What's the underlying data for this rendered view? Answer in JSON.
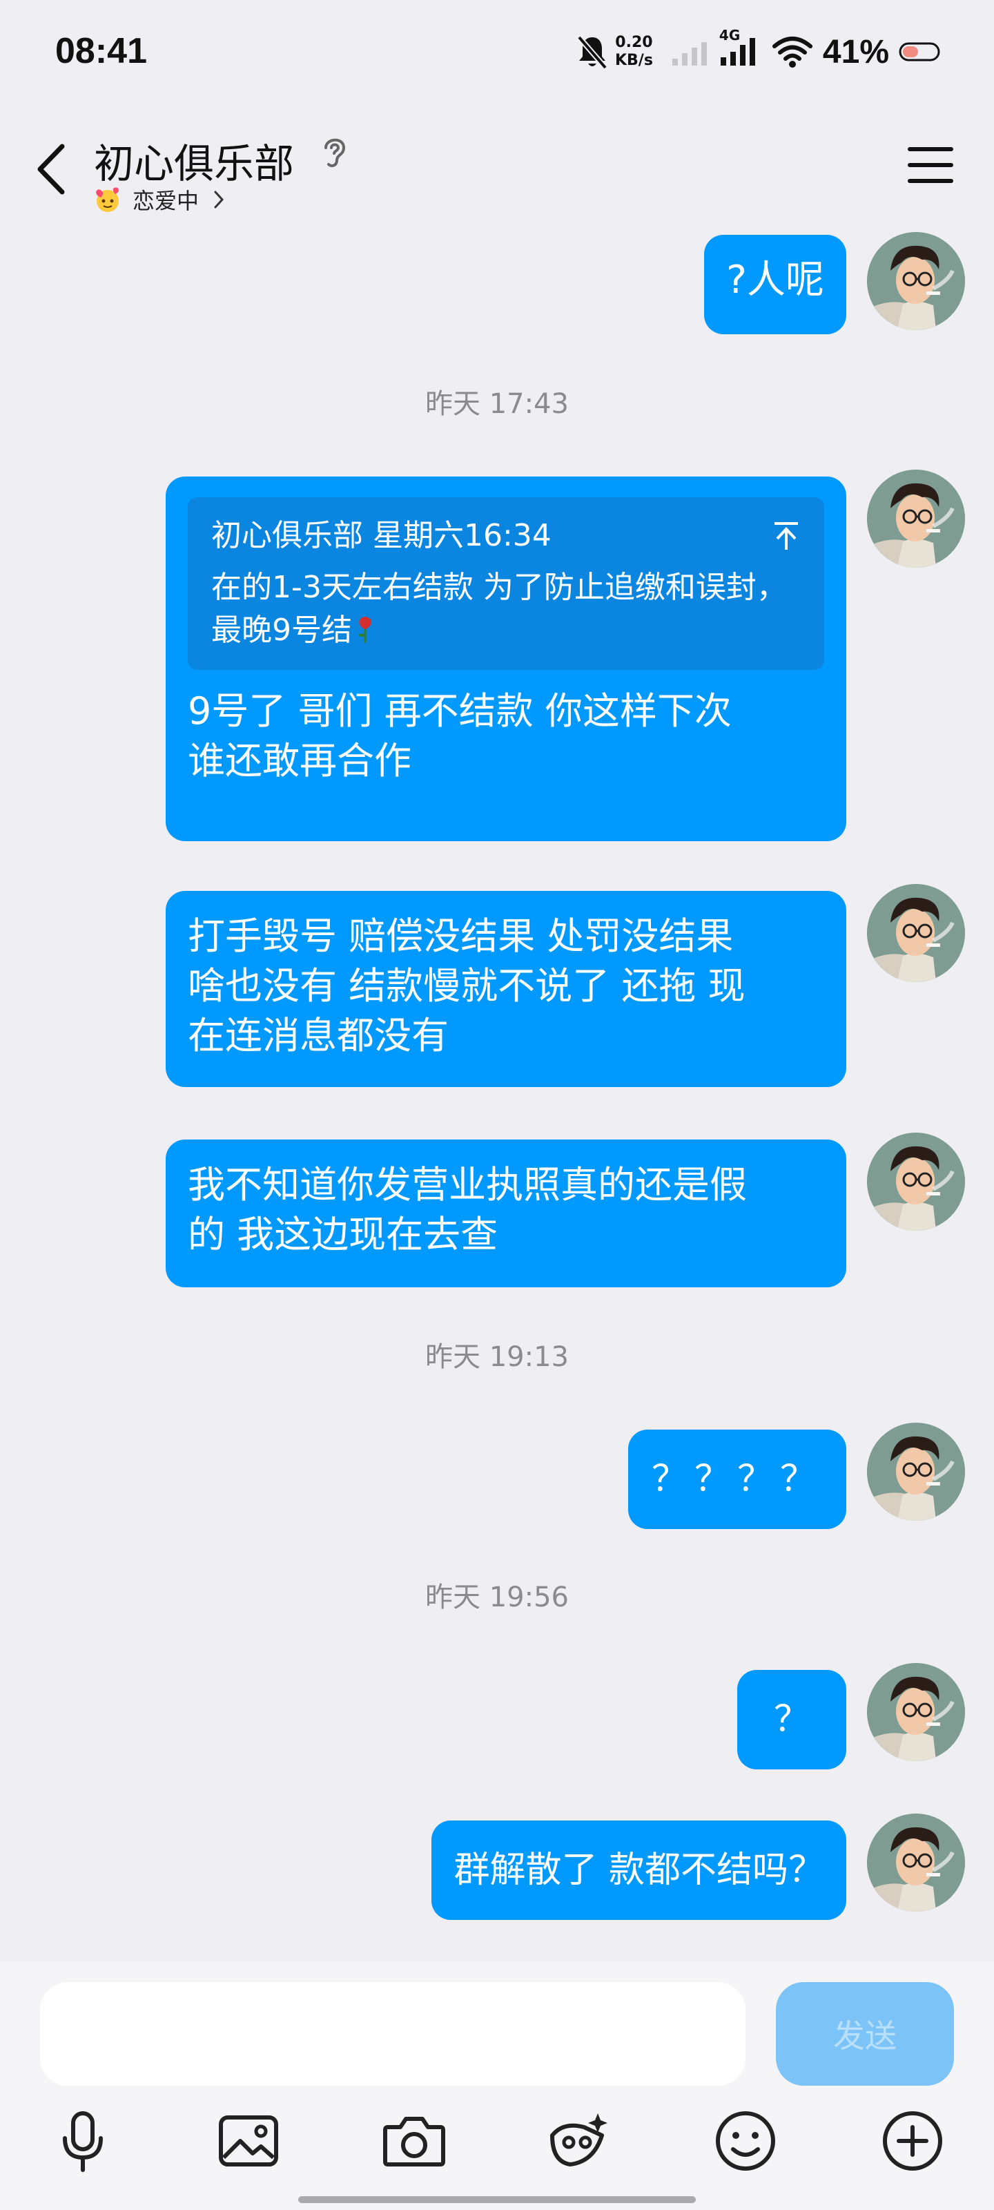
{
  "status_bar": {
    "time": "08:41",
    "net_speed_value": "0.20",
    "net_speed_unit": "KB/s",
    "network_type": "4G",
    "battery_percent": "41%"
  },
  "header": {
    "title": "初心俱乐部",
    "status": "恋爱中"
  },
  "messages": [
    {
      "type": "text",
      "text": "?人呢"
    },
    {
      "type": "timestamp",
      "text": "昨天 17:43"
    },
    {
      "type": "quote_reply",
      "quote_author": "初心俱乐部",
      "quote_time": "星期六16:34",
      "quote_text": "在的1-3天左右结款 为了防止追缴和误封，最晚9号结",
      "text_line1": "9号了 哥们 再不结款 你这样下次",
      "text_line2": "谁还敢再合作"
    },
    {
      "type": "text",
      "text_line1": "打手毁号  赔偿没结果 处罚没结果",
      "text_line2": "啥也没有  结款慢就不说了 还拖 现",
      "text_line3": "在连消息都没有"
    },
    {
      "type": "text",
      "text_line1": "我不知道你发营业执照真的还是假",
      "text_line2": "的 我这边现在去查"
    },
    {
      "type": "timestamp",
      "text": "昨天 19:13"
    },
    {
      "type": "text",
      "text": "？？？？"
    },
    {
      "type": "timestamp",
      "text": "昨天 19:56"
    },
    {
      "type": "text",
      "text": "？"
    },
    {
      "type": "text",
      "text": "群解散了 款都不结吗？"
    }
  ],
  "input": {
    "value": "",
    "send_label": "发送"
  },
  "colors": {
    "bubble": "#0099ff",
    "background": "#eeeef3",
    "send_disabled": "#7cc4f7"
  },
  "toolbar_icons": [
    "mic-icon",
    "image-icon",
    "camera-icon",
    "red-packet-icon",
    "emoji-icon",
    "plus-icon"
  ]
}
